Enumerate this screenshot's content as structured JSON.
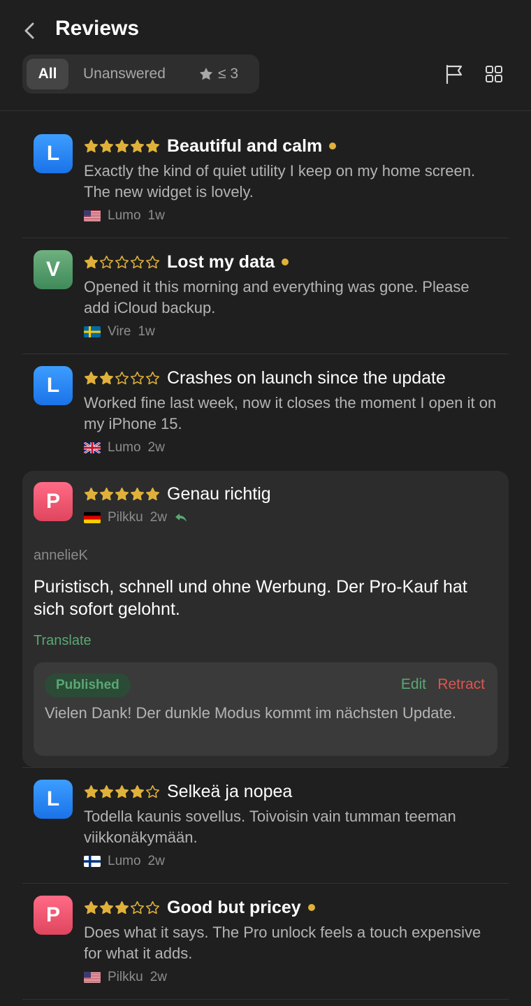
{
  "header": {
    "title": "Reviews",
    "filters": {
      "all": "All",
      "unanswered": "Unanswered",
      "rating": "≤ 3"
    }
  },
  "reviews": [
    {
      "avatar": "L",
      "avatar_color": "#2a86f5",
      "rating": 5,
      "title": "Beautiful and calm",
      "bold": true,
      "unread": true,
      "body": "Exactly the kind of quiet utility I keep on my home screen. The new widget is lovely.",
      "country": "US",
      "app": "Lumo",
      "age": "1w"
    },
    {
      "avatar": "V",
      "avatar_color": "#4f9b6b",
      "rating": 1,
      "title": "Lost my data",
      "bold": true,
      "unread": true,
      "body": "Opened it this morning and everything was gone. Please add iCloud backup.",
      "country": "SE",
      "app": "Vire",
      "age": "1w"
    },
    {
      "avatar": "L",
      "avatar_color": "#2a86f5",
      "rating": 2,
      "title": "Crashes on launch since the update",
      "bold": false,
      "unread": false,
      "body": "Worked fine last week, now it closes the moment I open it on my iPhone 15.",
      "country": "GB",
      "app": "Lumo",
      "age": "2w"
    },
    {
      "avatar": "P",
      "avatar_color": "#ef5670",
      "rating": 5,
      "title": "Genau richtig",
      "bold": false,
      "unread": false,
      "country": "DE",
      "app": "Pilkku",
      "age": "2w",
      "replied": true,
      "author": "annelieK",
      "body": "Puristisch, schnell und ohne Werbung. Der Pro-Kauf hat sich sofort gelohnt.",
      "translate_label": "Translate",
      "reply": {
        "status": "Published",
        "edit_label": "Edit",
        "retract_label": "Retract",
        "text": "Vielen Dank! Der dunkle Modus kommt im nächsten Update."
      }
    },
    {
      "avatar": "L",
      "avatar_color": "#2a86f5",
      "rating": 4,
      "title": "Selkeä ja nopea",
      "bold": false,
      "unread": false,
      "body": "Todella kaunis sovellus. Toivoisin vain tumman teeman viikkonäkymään.",
      "country": "FI",
      "app": "Lumo",
      "age": "2w"
    },
    {
      "avatar": "P",
      "avatar_color": "#ef5670",
      "rating": 3,
      "title": "Good but pricey",
      "bold": true,
      "unread": true,
      "body": "Does what it says. The Pro unlock feels a touch expensive for what it adds.",
      "country": "US",
      "app": "Pilkku",
      "age": "2w"
    }
  ]
}
